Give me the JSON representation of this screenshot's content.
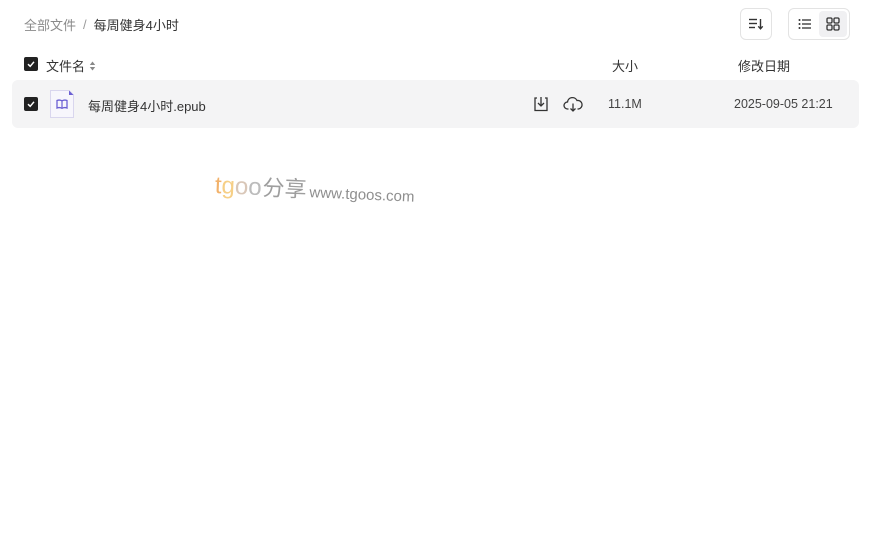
{
  "breadcrumb": {
    "root": "全部文件",
    "separator": "/",
    "current": "每周健身4小时"
  },
  "toolbar": {
    "sort_icon": "sort-icon",
    "view_list_icon": "list-view-icon",
    "view_grid_icon": "grid-view-icon",
    "active_view": "grid"
  },
  "table": {
    "header": {
      "name": "文件名",
      "size": "大小",
      "date": "修改日期",
      "select_all_checked": true
    },
    "rows": [
      {
        "checked": true,
        "icon": "epub-book-icon",
        "name": "每周健身4小时.epub",
        "size": "11.1M",
        "modified": "2025-09-05 21:21"
      }
    ]
  },
  "watermark": {
    "brand_chars": [
      "t",
      "g",
      "o",
      "o"
    ],
    "share": "分享",
    "url": "www.tgoos.com"
  },
  "colors": {
    "accent": "#6b5fd3",
    "row_bg": "#f4f4f5",
    "checkbox": "#222222"
  }
}
